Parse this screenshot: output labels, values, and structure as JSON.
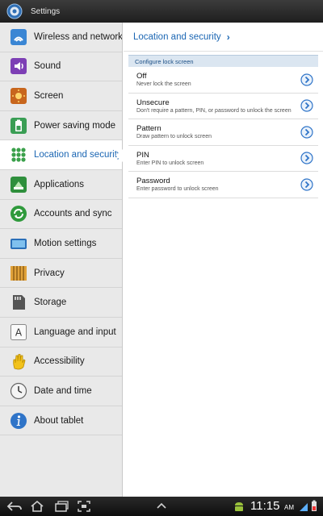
{
  "app": {
    "title": "Settings"
  },
  "sidebar": {
    "items": [
      {
        "label": "Wireless and networks",
        "icon": "wifi-icon"
      },
      {
        "label": "Sound",
        "icon": "sound-icon"
      },
      {
        "label": "Screen",
        "icon": "screen-icon"
      },
      {
        "label": "Power saving mode",
        "icon": "battery-icon"
      },
      {
        "label": "Location and security",
        "icon": "location-icon"
      },
      {
        "label": "Applications",
        "icon": "applications-icon"
      },
      {
        "label": "Accounts and sync",
        "icon": "sync-icon"
      },
      {
        "label": "Motion settings",
        "icon": "motion-icon"
      },
      {
        "label": "Privacy",
        "icon": "privacy-icon"
      },
      {
        "label": "Storage",
        "icon": "storage-icon"
      },
      {
        "label": "Language and input",
        "icon": "language-icon"
      },
      {
        "label": "Accessibility",
        "icon": "accessibility-icon"
      },
      {
        "label": "Date and time",
        "icon": "clock-icon"
      },
      {
        "label": "About tablet",
        "icon": "info-icon"
      }
    ],
    "active_index": 4
  },
  "main": {
    "breadcrumb": "Location and security",
    "section_header": "Configure lock screen",
    "options": [
      {
        "title": "Off",
        "subtitle": "Never lock the screen"
      },
      {
        "title": "Unsecure",
        "subtitle": "Don't require a pattern, PIN, or password to unlock the screen"
      },
      {
        "title": "Pattern",
        "subtitle": "Draw pattern to unlock screen"
      },
      {
        "title": "PIN",
        "subtitle": "Enter PIN to unlock screen"
      },
      {
        "title": "Password",
        "subtitle": "Enter password to unlock screen"
      }
    ]
  },
  "statusbar": {
    "time": "11:15",
    "ampm": "AM"
  },
  "colors": {
    "accent": "#1b66b3",
    "sidebar_bg": "#e9e9e9",
    "section_bg": "#dbe6f1"
  }
}
